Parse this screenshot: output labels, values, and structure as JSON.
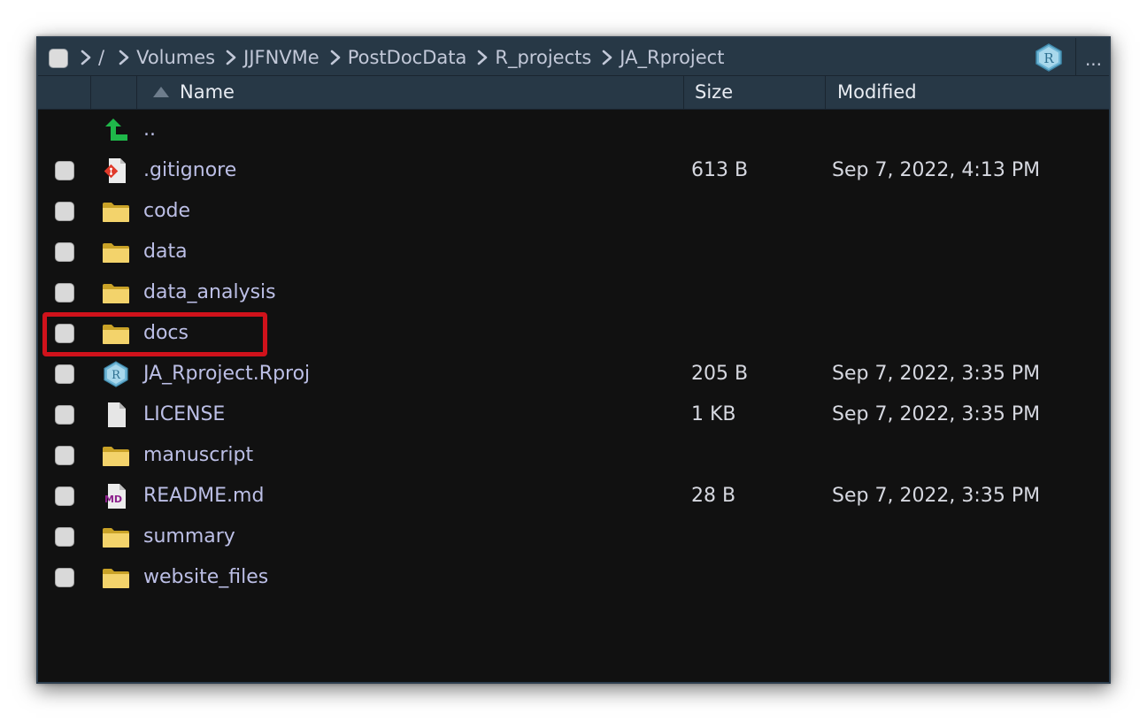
{
  "breadcrumb": {
    "items": [
      "/",
      "Volumes",
      "JJFNVMe",
      "PostDocData",
      "R_projects",
      "JA_Rproject"
    ]
  },
  "toolbar": {
    "project_icon": "r-project-icon",
    "more_label": "..."
  },
  "columns": {
    "name": "Name",
    "size": "Size",
    "modified": "Modified"
  },
  "parent_row": {
    "label": "..",
    "icon": "up-arrow-icon"
  },
  "files": [
    {
      "name": ".gitignore",
      "icon": "gitignore-file-icon",
      "size": "613 B",
      "modified": "Sep 7, 2022, 4:13 PM"
    },
    {
      "name": "code",
      "icon": "folder-icon",
      "size": "",
      "modified": ""
    },
    {
      "name": "data",
      "icon": "folder-icon",
      "size": "",
      "modified": ""
    },
    {
      "name": "data_analysis",
      "icon": "folder-icon",
      "size": "",
      "modified": ""
    },
    {
      "name": "docs",
      "icon": "folder-icon",
      "size": "",
      "modified": ""
    },
    {
      "name": "JA_Rproject.Rproj",
      "icon": "rproj-file-icon",
      "size": "205 B",
      "modified": "Sep 7, 2022, 3:35 PM"
    },
    {
      "name": "LICENSE",
      "icon": "text-file-icon",
      "size": "1 KB",
      "modified": "Sep 7, 2022, 3:35 PM"
    },
    {
      "name": "manuscript",
      "icon": "folder-icon",
      "size": "",
      "modified": ""
    },
    {
      "name": "README.md",
      "icon": "markdown-file-icon",
      "size": "28 B",
      "modified": "Sep 7, 2022, 3:35 PM"
    },
    {
      "name": "summary",
      "icon": "folder-icon",
      "size": "",
      "modified": ""
    },
    {
      "name": "website_files",
      "icon": "folder-icon",
      "size": "",
      "modified": ""
    }
  ],
  "highlighted_item": "docs",
  "colors": {
    "toolbar_bg": "#273846",
    "pane_bg": "#111111",
    "link_text": "#bcbfe6",
    "highlight": "#d0121b"
  }
}
